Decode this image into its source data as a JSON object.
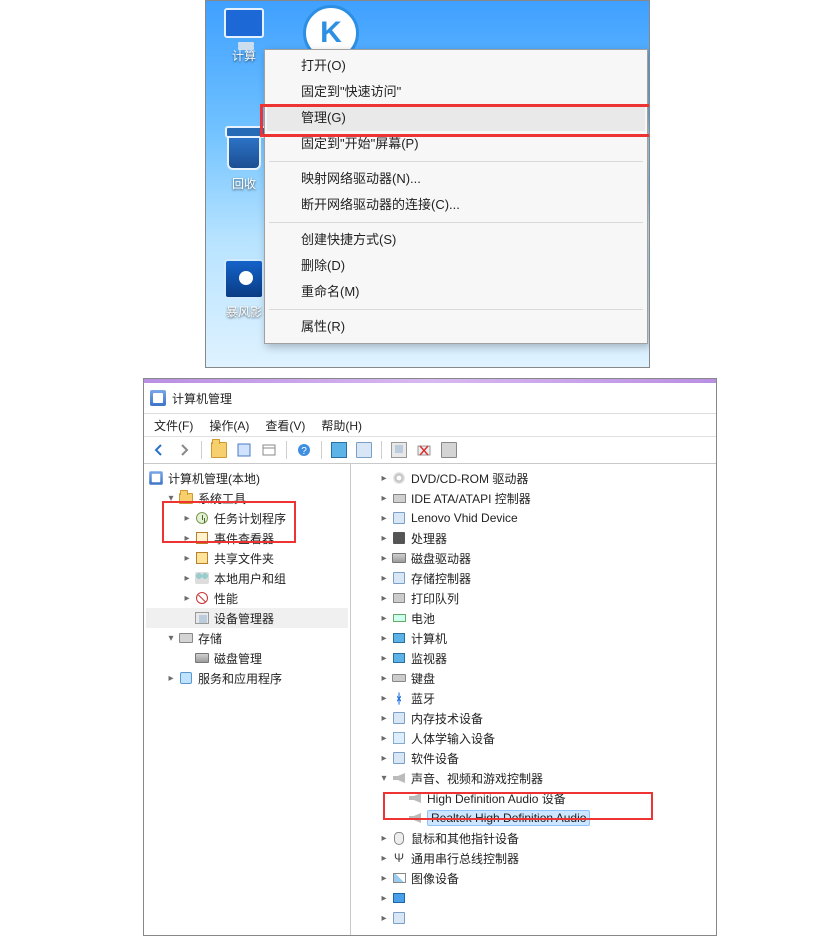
{
  "desktop": {
    "icons": {
      "computer": "计算",
      "recycle": "回收",
      "baofeng": "暴风影"
    },
    "context_menu": {
      "open": "打开(O)",
      "pin_quick_access": "固定到\"快速访问\"",
      "manage": "管理(G)",
      "pin_start": "固定到\"开始\"屏幕(P)",
      "map_drive": "映射网络驱动器(N)...",
      "disconnect_drive": "断开网络驱动器的连接(C)...",
      "create_shortcut": "创建快捷方式(S)",
      "delete": "删除(D)",
      "rename": "重命名(M)",
      "properties": "属性(R)"
    }
  },
  "mgmt": {
    "title": "计算机管理",
    "menu": {
      "file": "文件(F)",
      "action": "操作(A)",
      "view": "查看(V)",
      "help": "帮助(H)"
    },
    "tree": {
      "root": "计算机管理(本地)",
      "system_tools": "系统工具",
      "task_scheduler": "任务计划程序",
      "event_viewer": "事件查看器",
      "shared_folders": "共享文件夹",
      "local_users": "本地用户和组",
      "performance": "性能",
      "device_manager": "设备管理器",
      "storage": "存储",
      "disk_mgmt": "磁盘管理",
      "services_apps": "服务和应用程序"
    },
    "dev": {
      "dvd": "DVD/CD-ROM 驱动器",
      "ide": "IDE ATA/ATAPI 控制器",
      "lenovo": "Lenovo Vhid Device",
      "cpu": "处理器",
      "disk_drive": "磁盘驱动器",
      "storage_ctrl": "存储控制器",
      "print_queue": "打印队列",
      "battery": "电池",
      "computer": "计算机",
      "monitor": "监视器",
      "keyboard": "键盘",
      "bluetooth": "蓝牙",
      "memory": "内存技术设备",
      "hid": "人体学输入设备",
      "software": "软件设备",
      "sound": "声音、视频和游戏控制器",
      "hda": "High Definition Audio 设备",
      "realtek": "Realtek High Definition Audio",
      "mouse": "鼠标和其他指针设备",
      "usb": "通用串行总线控制器",
      "imaging": "图像设备"
    }
  }
}
